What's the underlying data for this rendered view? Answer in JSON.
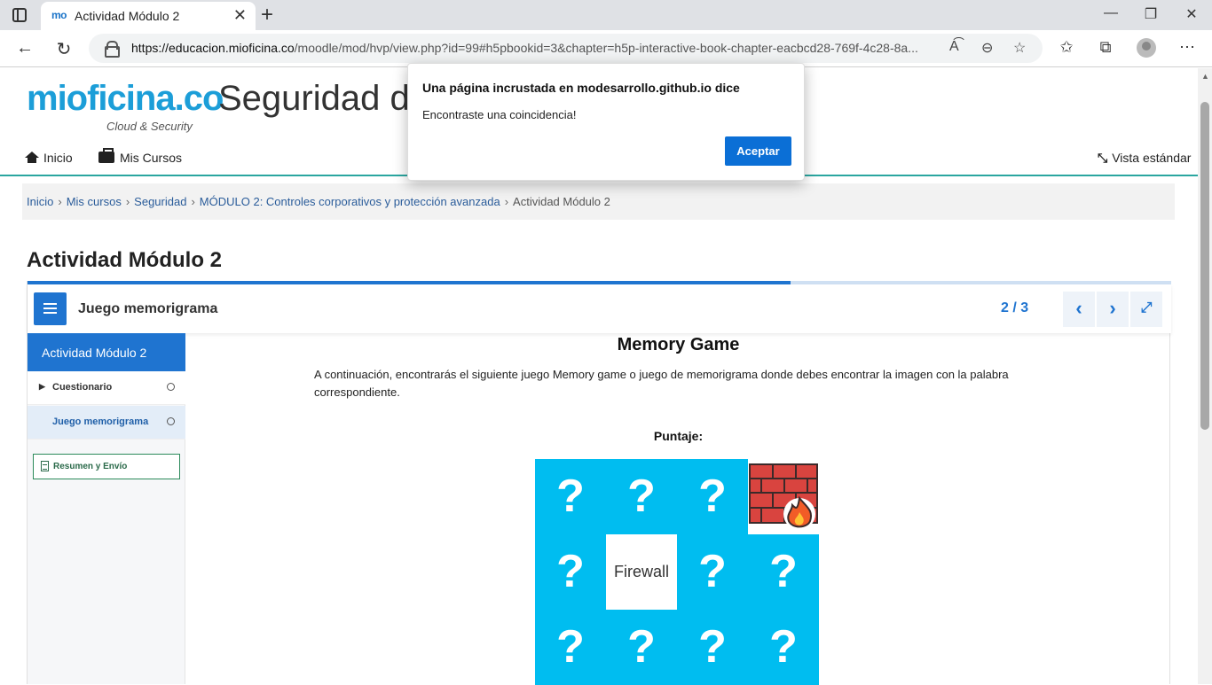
{
  "browser": {
    "tab_title": "Actividad Módulo 2",
    "tab_favicon": "mo",
    "url_domain": "https://educacion.mioficina.co",
    "url_path": "/moodle/mod/hvp/view.php?id=99#h5pbookid=3&chapter=h5p-interactive-book-chapter-eacbcd28-769f-4c28-8a..."
  },
  "site": {
    "logo_main": "mioficina.co",
    "logo_sub": "Cloud & Security",
    "title": "Seguridad de"
  },
  "nav": {
    "home": "Inicio",
    "courses": "Mis Cursos",
    "view": "Vista estándar"
  },
  "breadcrumb": {
    "items": [
      "Inicio",
      "Mis cursos",
      "Seguridad",
      "MÓDULO 2: Controles corporativos y protección avanzada"
    ],
    "current": "Actividad Módulo 2"
  },
  "page": {
    "title": "Actividad Módulo 2"
  },
  "book": {
    "progress_fraction": 0.667,
    "chapter_title": "Juego memorigrama",
    "counter": "2 / 3",
    "sidebar_title": "Actividad Módulo 2",
    "chapters": [
      "Cuestionario",
      "Juego memorigrama"
    ],
    "submit_label": "Resumen y Envío"
  },
  "game": {
    "title": "Memory Game",
    "description": "A continuación, encontrarás el siguiente juego Memory game o juego de memorigrama donde debes encontrar la imagen con la palabra correspondiente.",
    "score_label": "Puntaje:",
    "hidden_symbol": "?",
    "revealed_word": "Firewall",
    "revealed_image": "firewall-icon"
  },
  "dialog": {
    "title": "Una página incrustada en modesarrollo.github.io dice",
    "message": "Encontraste una coincidencia!",
    "button": "Aceptar"
  },
  "colors": {
    "accent": "#1f74d0",
    "card": "#00bdf0",
    "teal_line": "#2aa6a0"
  }
}
